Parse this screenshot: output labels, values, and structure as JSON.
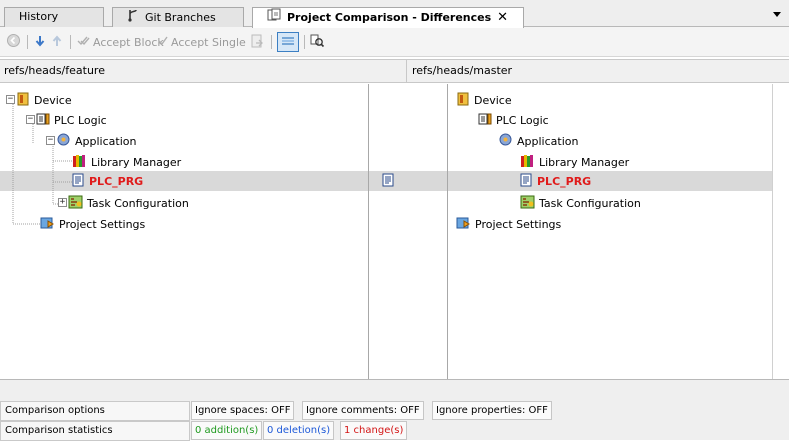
{
  "tabs": [
    {
      "label": "History",
      "icon": "history-icon"
    },
    {
      "label": "Git Branches",
      "icon": "git-branch-icon"
    },
    {
      "label": "Project Comparison - Differences",
      "icon": "compare-icon",
      "active": true
    }
  ],
  "toolbar": {
    "accept_block": "Accept Block",
    "accept_single": "Accept Single"
  },
  "branches": {
    "left": "refs/heads/feature",
    "right": "refs/heads/master"
  },
  "tree": {
    "left": {
      "device": "Device",
      "plc_logic": "PLC Logic",
      "application": "Application",
      "library_manager": "Library Manager",
      "plc_prg": "PLC_PRG",
      "task_configuration": "Task Configuration",
      "project_settings": "Project Settings"
    },
    "right": {
      "device": "Device",
      "plc_logic": "PLC Logic",
      "application": "Application",
      "library_manager": "Library Manager",
      "plc_prg": "PLC_PRG",
      "task_configuration": "Task Configuration",
      "project_settings": "Project Settings"
    }
  },
  "comparison_options": {
    "label": "Comparison options",
    "items": [
      "Ignore spaces: OFF",
      "Ignore comments: OFF",
      "Ignore properties: OFF"
    ]
  },
  "comparison_statistics": {
    "label": "Comparison statistics",
    "additions": "0 addition(s)",
    "deletions": "0 deletion(s)",
    "changes": "1 change(s)"
  },
  "colors": {
    "changed": "#e01b1b",
    "additions": "#1f9a1f",
    "deletions": "#1c58d8",
    "changes": "#d31515",
    "highlight_row": "#d9d9d9"
  }
}
